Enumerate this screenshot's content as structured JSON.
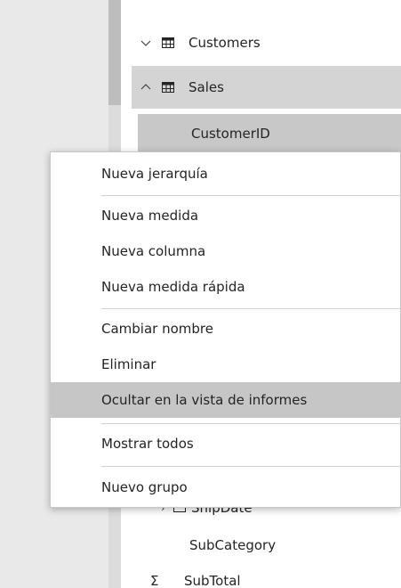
{
  "fields_pane": {
    "tables": [
      {
        "name": "Customers",
        "expanded": false
      },
      {
        "name": "Sales",
        "expanded": true
      }
    ],
    "fields": {
      "customer_id": "CustomerID",
      "ship_date": "ShipDate",
      "sub_category": "SubCategory",
      "sub_total": "SubTotal"
    }
  },
  "context_menu": {
    "groups": [
      [
        "Nueva jerarquía"
      ],
      [
        "Nueva medida",
        "Nueva columna",
        "Nueva medida rápida"
      ],
      [
        "Cambiar nombre",
        "Eliminar",
        "Ocultar en la vista de informes"
      ],
      [
        "Mostrar todos"
      ],
      [
        "Nuevo grupo"
      ]
    ],
    "highlighted_item": "Ocultar en la vista de informes"
  },
  "icons": {
    "collapsed_chevron": "chevron-down-icon",
    "expanded_chevron": "chevron-up-icon",
    "table": "table-icon",
    "sum": "sigma-icon"
  },
  "colors": {
    "menu_highlight": "#c6c6c6",
    "selected_row": "#d4d4d4",
    "pane_background": "#ffffff"
  }
}
